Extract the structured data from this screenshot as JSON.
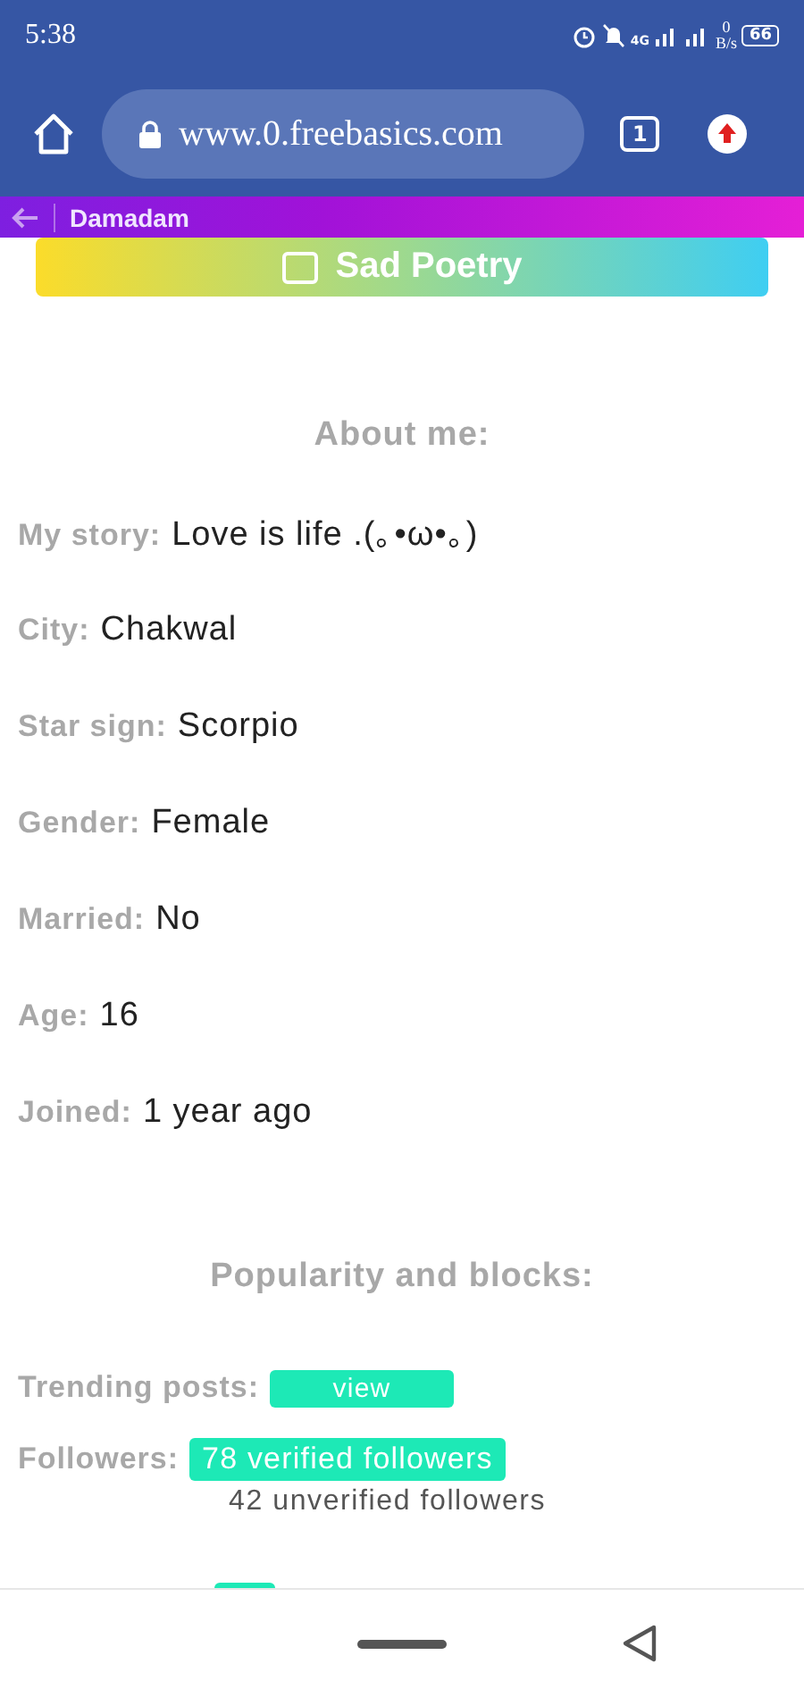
{
  "status_bar": {
    "time": "5:38",
    "network": "4G",
    "speed_value": "0",
    "speed_unit": "B/s",
    "battery": "66"
  },
  "browser": {
    "url": "www.0.freebasics.com",
    "tab_count": "1"
  },
  "site_bar": {
    "title": "Damadam"
  },
  "category_button": {
    "label": "Sad Poetry"
  },
  "about": {
    "heading": "About me:",
    "fields": [
      {
        "label": "My story:",
        "value": "Love is life .(｡•ω•｡)"
      },
      {
        "label": "City:",
        "value": "Chakwal"
      },
      {
        "label": "Star sign:",
        "value": "Scorpio"
      },
      {
        "label": "Gender:",
        "value": "Female"
      },
      {
        "label": "Married:",
        "value": "No"
      },
      {
        "label": "Age:",
        "value": "16"
      },
      {
        "label": "Joined:",
        "value": "1 year ago"
      }
    ]
  },
  "popularity": {
    "heading": "Popularity and blocks:",
    "trending_label": "Trending posts:",
    "trending_button": "view",
    "followers_label": "Followers:",
    "verified": "78 verified followers",
    "unverified": "42 unverified followers"
  }
}
